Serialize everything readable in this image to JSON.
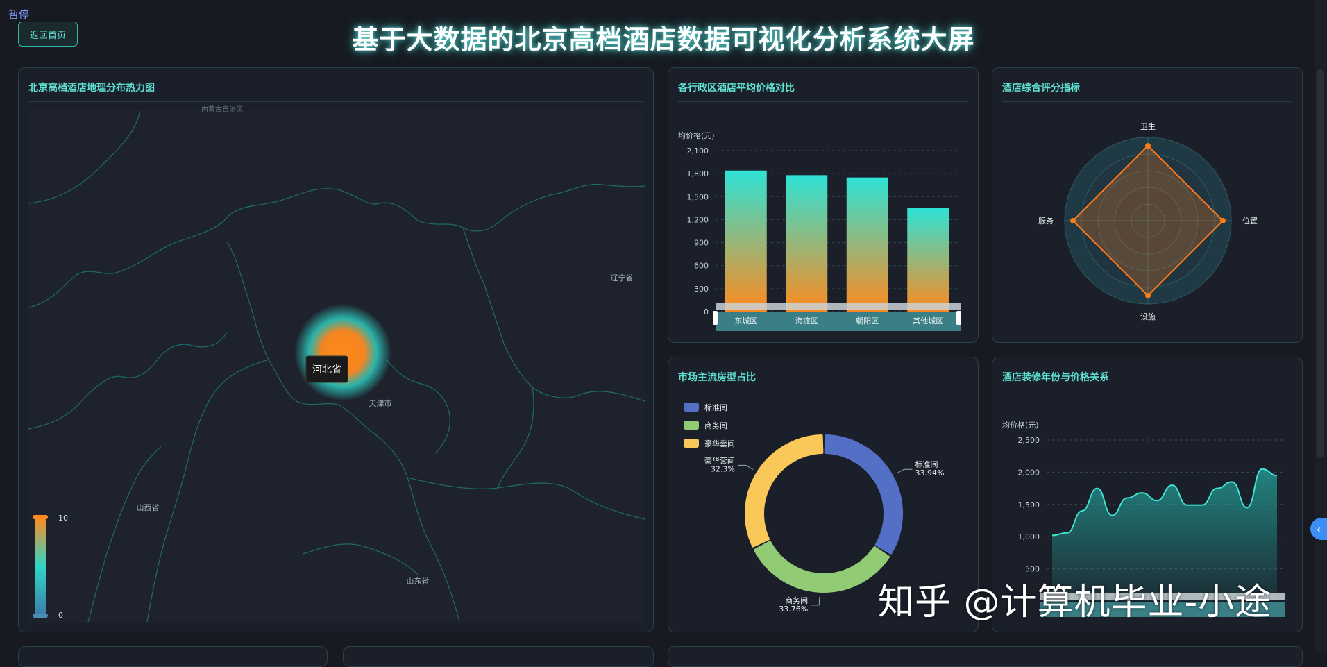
{
  "page": {
    "pause_label": "暂停",
    "back_button": "返回首页",
    "title": "基于大数据的北京高档酒店数据可视化分析系统大屏"
  },
  "panels": {
    "heatmap": {
      "title": "北京高档酒店地理分布热力图",
      "tooltip": "河北省",
      "provinces": [
        "辽宁省",
        "天津市",
        "山西省",
        "山东省",
        "内蒙古自治区"
      ],
      "visual_map": {
        "max": "10",
        "min": "0"
      },
      "colors": {
        "hot": "#ff8a1e",
        "mid": "#2fd6c9",
        "cold": "#3aa0b8"
      }
    },
    "price": {
      "title": "各行政区酒店平均价格对比"
    },
    "radar": {
      "title": "酒店综合评分指标"
    },
    "room": {
      "title": "市场主流房型占比"
    },
    "year": {
      "title": "酒店装修年份与价格关系"
    }
  },
  "watermark": "知乎 @计算机毕业-小途",
  "chart_data": [
    {
      "type": "bar",
      "title": "各行政区酒店平均价格对比",
      "ylabel": "均价格(元)",
      "categories": [
        "东城区",
        "海淀区",
        "朝阳区",
        "其他城区"
      ],
      "values": [
        1840,
        1780,
        1750,
        1350
      ],
      "ylim": [
        0,
        2100
      ],
      "yticks": [
        "0",
        "300",
        "600",
        "900",
        "1,200",
        "1,500",
        "1,800",
        "2,100"
      ],
      "grid": true,
      "colors": {
        "top": "#2ee3d6",
        "bottom": "#ff8a1e"
      }
    },
    {
      "type": "radar",
      "title": "酒店综合评分指标",
      "indicators": [
        "卫生",
        "位置",
        "设施",
        "服务"
      ],
      "values": [
        0.9,
        0.9,
        0.9,
        0.9
      ],
      "colors": {
        "line": "#ff7a1a",
        "fill": "rgba(255,122,26,0.25)"
      }
    },
    {
      "type": "pie",
      "title": "市场主流房型占比",
      "categories": [
        "标准间",
        "商务间",
        "豪华套间"
      ],
      "values": [
        33.94,
        33.76,
        32.3
      ],
      "labels": [
        "标准间\n33.94%",
        "商务间\n33.76%",
        "豪华套间\n32.3%"
      ],
      "legend": "top-left",
      "colors": [
        "#5470c6",
        "#91cc75",
        "#fac858"
      ]
    },
    {
      "type": "area",
      "title": "酒店装修年份与价格关系",
      "ylabel": "均价格(元)",
      "ylim": [
        0,
        2500
      ],
      "yticks": [
        "500",
        "1,000",
        "1,500",
        "2,000",
        "2,500"
      ],
      "values": [
        1020,
        1060,
        1400,
        1750,
        1330,
        1600,
        1680,
        1560,
        1800,
        1490,
        1490,
        1750,
        1850,
        1450,
        2050,
        1950
      ],
      "grid": true,
      "colors": {
        "line": "#3fe3d3",
        "fill": "#24a59c"
      }
    }
  ]
}
